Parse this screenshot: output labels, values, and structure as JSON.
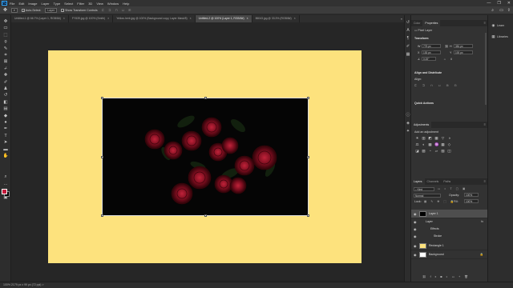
{
  "app": {
    "logo": "Ps",
    "menu": [
      "File",
      "Edit",
      "Image",
      "Layer",
      "Type",
      "Select",
      "Filter",
      "3D",
      "View",
      "Window",
      "Help"
    ],
    "window_controls": [
      "—",
      "❐",
      "✕"
    ]
  },
  "options_bar": {
    "auto_select_label": "Auto-Select:",
    "auto_select_value": "Layer",
    "show_transform_label": "Show Transform Controls"
  },
  "tabs": [
    {
      "label": "Untitled-1 @ 66.7% (Layer 1, RGB/8#)",
      "active": false
    },
    {
      "label": "FY539.jpg @ 100% (Smith)",
      "active": false
    },
    {
      "label": "Yellow-herb.jpg @ 100% (Background copy, Layer Mask/8)",
      "active": false
    },
    {
      "label": "Untitled-2 @ 100% (Layer 1, RGB/8#)",
      "active": true
    },
    {
      "label": "86043.jpg @ 33.3% (RGB/8#)",
      "active": false
    }
  ],
  "tab_close": "×",
  "tab_overflow": "»",
  "status_bar": {
    "text": "100%   2179 px x 99 px (72 ppi)   >"
  },
  "tools": [
    {
      "icon": "move-icon",
      "glyph": "✥"
    },
    {
      "icon": "artboard-icon",
      "glyph": "▭"
    },
    {
      "icon": "marquee-icon",
      "glyph": "⬚"
    },
    {
      "icon": "lasso-icon",
      "glyph": "ϙ"
    },
    {
      "icon": "quick-select-icon",
      "glyph": "✎"
    },
    {
      "icon": "crop-icon",
      "glyph": "⌗"
    },
    {
      "icon": "frame-icon",
      "glyph": "⊠"
    },
    {
      "icon": "eyedropper-icon",
      "glyph": "⌿"
    },
    {
      "icon": "healing-icon",
      "glyph": "✚"
    },
    {
      "icon": "brush-icon",
      "glyph": "✐"
    },
    {
      "icon": "stamp-icon",
      "glyph": "♟"
    },
    {
      "icon": "history-brush-icon",
      "glyph": "↺"
    },
    {
      "icon": "eraser-icon",
      "glyph": "◧"
    },
    {
      "icon": "gradient-icon",
      "glyph": "▤"
    },
    {
      "icon": "blur-icon",
      "glyph": "◆"
    },
    {
      "icon": "dodge-icon",
      "glyph": "●"
    },
    {
      "icon": "pen-icon",
      "glyph": "✒"
    },
    {
      "icon": "type-icon",
      "glyph": "T"
    },
    {
      "icon": "path-select-icon",
      "glyph": "➤"
    },
    {
      "icon": "shape-icon",
      "glyph": "▬"
    },
    {
      "icon": "hand-icon",
      "glyph": "✋"
    },
    {
      "icon": "zoom-icon",
      "glyph": "⌕"
    },
    {
      "icon": "more-tools-icon",
      "glyph": "…"
    },
    {
      "icon": "quick-mask-icon",
      "glyph": "◘"
    },
    {
      "icon": "screen-mode-icon",
      "glyph": "▣"
    }
  ],
  "colors": {
    "foreground": "#c41b3b",
    "background": "#000000",
    "artboard": "#fde27d",
    "accent": "#31a8ff"
  },
  "properties_panel": {
    "tabs": [
      "Color",
      "Properties"
    ],
    "menu": "≡",
    "layer_kind": "Pixel Layer",
    "transform_label": "Transform",
    "w_label": "W",
    "w_value": "775 px",
    "h_label": "H",
    "h_value": "381 px",
    "x_label": "X",
    "x_value": "130 px",
    "y_label": "Y",
    "y_value": "100 px",
    "angle_value": "0.00°",
    "align_label": "Align and Distribute",
    "align_sub": "Align:",
    "quick_actions_label": "Quick Actions"
  },
  "adjustments_panel": {
    "tab": "Adjustments",
    "menu": "≡",
    "hint": "Add an adjustment",
    "row1": [
      "☀",
      "▥",
      "◩",
      "▦",
      "▽",
      "◑"
    ],
    "row2": [
      "⚖",
      "◐",
      "▩",
      "♒",
      "▦",
      "◇"
    ],
    "row3": [
      "◪",
      "▨",
      "◔",
      "▱",
      "▧",
      "◫"
    ]
  },
  "layers_panel": {
    "tabs": [
      "Layers",
      "Channels",
      "Paths"
    ],
    "menu": "≡",
    "filter_kind": "Kind",
    "blend_mode": "Normal",
    "opacity_label": "Opacity:",
    "opacity_value": "100%",
    "lock_label": "Lock:",
    "fill_label": "Fill:",
    "fill_value": "100%",
    "layers": [
      {
        "name": "Layer 1",
        "selected": true,
        "thumb": "#000000"
      },
      {
        "name": "Layer",
        "selected": false,
        "thumb": ""
      },
      {
        "name": "Effects",
        "selected": false,
        "thumb": ""
      },
      {
        "name": "Stroke",
        "selected": false,
        "thumb": ""
      },
      {
        "name": "Rectangle 1",
        "selected": false,
        "thumb": "#fde27d"
      },
      {
        "name": "Background",
        "selected": false,
        "thumb": "#ffffff"
      }
    ],
    "footer_icons": [
      "⛓",
      "fx",
      "◙",
      "◐",
      "▭",
      "+",
      "🗑"
    ]
  },
  "right_strip": [
    {
      "label": "Learn",
      "icon": "◉"
    },
    {
      "label": "Libraries",
      "icon": "▦"
    }
  ]
}
